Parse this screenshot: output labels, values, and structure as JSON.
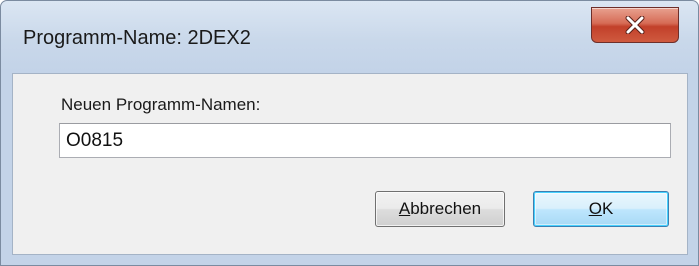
{
  "window": {
    "title": "Programm-Name: 2DEX2"
  },
  "form": {
    "label": "Neuen Programm-Namen:",
    "value": "O0815"
  },
  "buttons": {
    "cancel_mnemonic": "A",
    "cancel_rest": "bbrechen",
    "ok_mnemonic": "O",
    "ok_rest": "K"
  },
  "icons": {
    "close": "close-icon"
  },
  "colors": {
    "close_button": "#c9452f",
    "ok_focus_border": "#3c7fb1"
  }
}
